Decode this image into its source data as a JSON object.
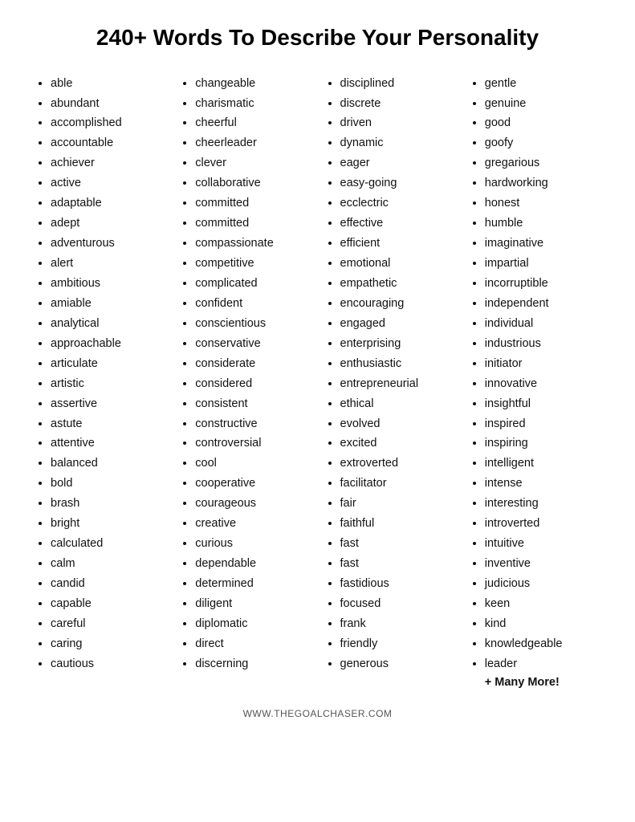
{
  "title": "240+ Words To Describe Your Personality",
  "footer": "WWW.THEGOALCHASER.COM",
  "more_label": "+ Many More!",
  "columns": [
    {
      "id": "col1",
      "items": [
        "able",
        "abundant",
        "accomplished",
        "accountable",
        "achiever",
        "active",
        "adaptable",
        "adept",
        "adventurous",
        "alert",
        "ambitious",
        "amiable",
        "analytical",
        "approachable",
        "articulate",
        "artistic",
        "assertive",
        "astute",
        "attentive",
        "balanced",
        "bold",
        "brash",
        "bright",
        "calculated",
        "calm",
        "candid",
        "capable",
        "careful",
        "caring",
        "cautious"
      ]
    },
    {
      "id": "col2",
      "items": [
        "changeable",
        "charismatic",
        "cheerful",
        "cheerleader",
        "clever",
        "collaborative",
        "committed",
        "committed",
        "compassionate",
        "competitive",
        "complicated",
        "confident",
        "conscientious",
        "conservative",
        "considerate",
        "considered",
        "consistent",
        "constructive",
        "controversial",
        "cool",
        "cooperative",
        "courageous",
        "creative",
        "curious",
        "dependable",
        "determined",
        "diligent",
        "diplomatic",
        "direct",
        "discerning"
      ]
    },
    {
      "id": "col3",
      "items": [
        "disciplined",
        "discrete",
        "driven",
        "dynamic",
        "eager",
        "easy-going",
        "ecclectric",
        "effective",
        "efficient",
        "emotional",
        "empathetic",
        "encouraging",
        "engaged",
        "enterprising",
        "enthusiastic",
        "entrepreneurial",
        "ethical",
        "evolved",
        "excited",
        "extroverted",
        "facilitator",
        "fair",
        "faithful",
        "fast",
        "fast",
        "fastidious",
        "focused",
        "frank",
        "friendly",
        "generous"
      ]
    },
    {
      "id": "col4",
      "items": [
        "gentle",
        "genuine",
        "good",
        "goofy",
        "gregarious",
        "hardworking",
        "honest",
        "humble",
        "imaginative",
        "impartial",
        "incorruptible",
        "independent",
        "individual",
        "industrious",
        "initiator",
        "innovative",
        "insightful",
        "inspired",
        "inspiring",
        "intelligent",
        "intense",
        "interesting",
        "introverted",
        "intuitive",
        "inventive",
        "judicious",
        "keen",
        "kind",
        "knowledgeable",
        "leader"
      ]
    }
  ]
}
